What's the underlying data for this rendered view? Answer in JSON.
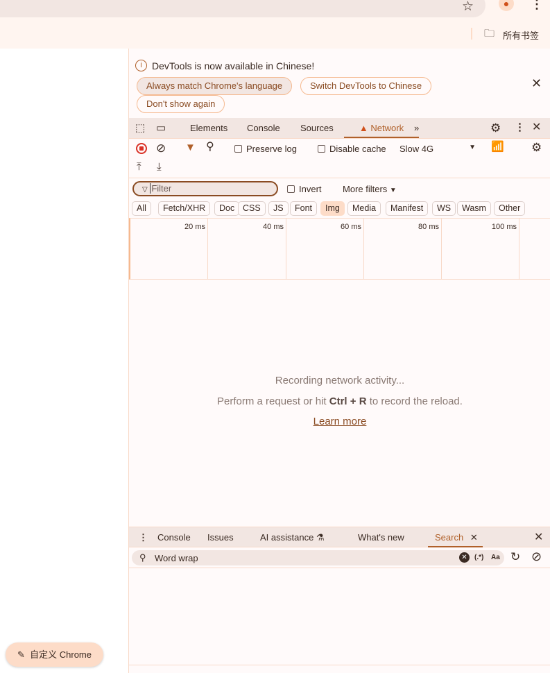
{
  "browser": {
    "bookmarks_label": "所有书签",
    "customize_label": "自定义 Chrome"
  },
  "infobar": {
    "message": "DevTools is now available in Chinese!",
    "buttons": [
      "Always match Chrome's language",
      "Switch DevTools to Chinese",
      "Don't show again"
    ]
  },
  "main_tabs": {
    "items": [
      "Elements",
      "Console",
      "Sources",
      "Network"
    ],
    "active": "Network"
  },
  "toolbar": {
    "preserve_log": "Preserve log",
    "disable_cache": "Disable cache",
    "throttle": "Slow 4G"
  },
  "filter": {
    "placeholder": "Filter",
    "invert": "Invert",
    "more_filters": "More filters"
  },
  "type_chips": [
    "All",
    "Fetch/XHR",
    "Doc",
    "CSS",
    "JS",
    "Font",
    "Img",
    "Media",
    "Manifest",
    "WS",
    "Wasm",
    "Other"
  ],
  "active_chip": "Img",
  "timeline": {
    "ticks": [
      "20 ms",
      "40 ms",
      "60 ms",
      "80 ms",
      "100 ms"
    ]
  },
  "empty": {
    "line1": "Recording network activity...",
    "line2_pre": "Perform a request or hit ",
    "line2_key": "Ctrl + R",
    "line2_post": " to record the reload.",
    "link": "Learn more"
  },
  "drawer": {
    "tabs": [
      "Console",
      "Issues",
      "AI assistance",
      "What's new",
      "Search"
    ],
    "active": "Search",
    "search_value": "Word wrap",
    "regex_label": "(.*)",
    "case_label": "Aa"
  },
  "colors": {
    "accent": "#b0602a",
    "record": "#d93025",
    "chip_active": "#fddcc8"
  }
}
